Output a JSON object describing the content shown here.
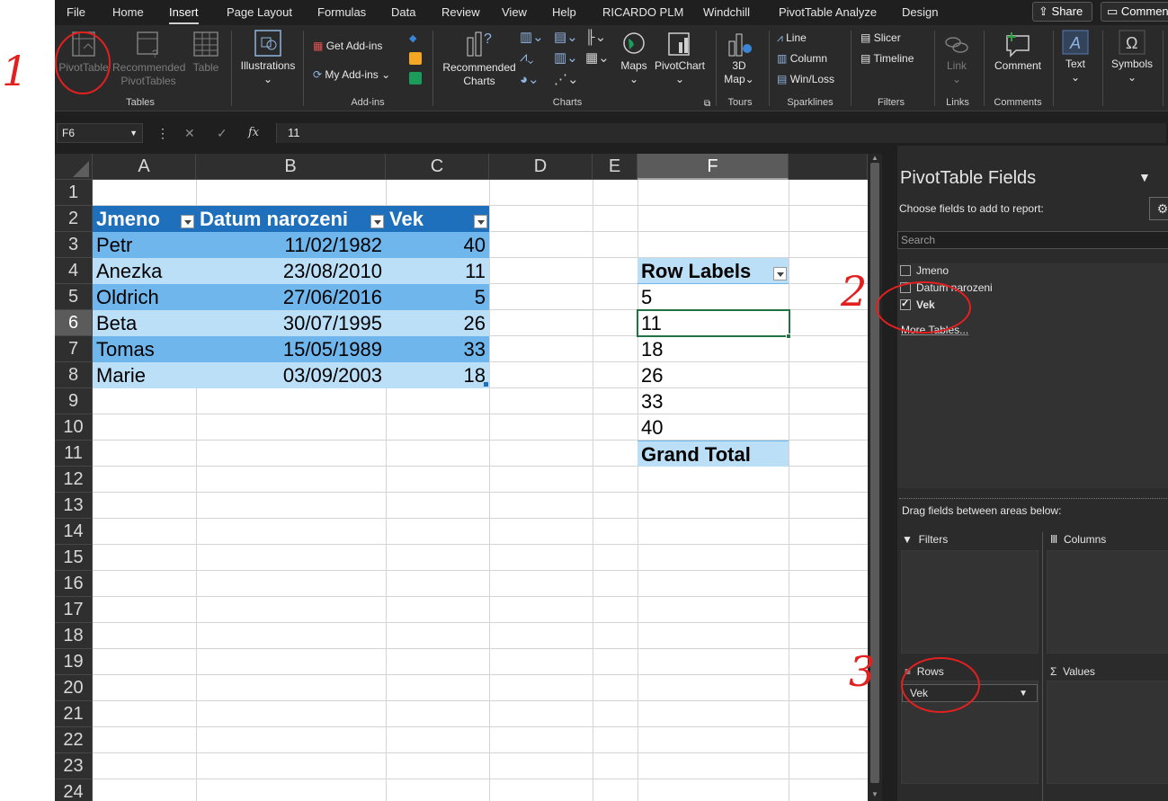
{
  "menu": {
    "tabs": [
      "File",
      "Home",
      "Insert",
      "Page Layout",
      "Formulas",
      "Data",
      "Review",
      "View",
      "Help",
      "RICARDO PLM",
      "Windchill",
      "PivotTable Analyze",
      "Design"
    ],
    "active": "Insert",
    "share": "Share",
    "comments": "Comments"
  },
  "ribbon": {
    "tables": {
      "pivottable": "PivotTable",
      "recommended_pivot_1": "Recommended",
      "recommended_pivot_2": "PivotTables",
      "table": "Table",
      "label": "Tables"
    },
    "illustrations": {
      "label_btn": "Illustrations"
    },
    "addins": {
      "get": "Get Add-ins",
      "my": "My Add-ins",
      "label": "Add-ins"
    },
    "charts": {
      "recommended_1": "Recommended",
      "recommended_2": "Charts",
      "maps": "Maps",
      "pivotchart": "PivotChart",
      "label": "Charts"
    },
    "tours": {
      "map_1": "3D",
      "map_2": "Map",
      "label": "Tours"
    },
    "sparklines": {
      "line": "Line",
      "column": "Column",
      "winloss": "Win/Loss",
      "label": "Sparklines"
    },
    "filters": {
      "slicer": "Slicer",
      "timeline": "Timeline",
      "label": "Filters"
    },
    "links": {
      "link": "Link",
      "label": "Links"
    },
    "comments": {
      "comment": "Comment",
      "label": "Comments"
    },
    "text": {
      "text": "Text"
    },
    "symbols": {
      "symbols": "Symbols"
    }
  },
  "formula_bar": {
    "name_box": "F6",
    "fx": "fx",
    "value": "11"
  },
  "sheet": {
    "columns": [
      "A",
      "B",
      "C",
      "D",
      "E",
      "F"
    ],
    "selected_column": "F",
    "rows": [
      "1",
      "2",
      "3",
      "4",
      "5",
      "6",
      "7",
      "8",
      "9",
      "10",
      "11",
      "12",
      "13",
      "14",
      "15",
      "16",
      "17",
      "18",
      "19",
      "20",
      "21",
      "22",
      "23",
      "24"
    ],
    "selected_row": "6",
    "table_headers": [
      "Jmeno",
      "Datum narozeni",
      "Vek"
    ],
    "table_rows": [
      [
        "Petr",
        "11/02/1982",
        "40"
      ],
      [
        "Anezka",
        "23/08/2010",
        "11"
      ],
      [
        "Oldrich",
        "27/06/2016",
        "5"
      ],
      [
        "Beta",
        "30/07/1995",
        "26"
      ],
      [
        "Tomas",
        "15/05/1989",
        "33"
      ],
      [
        "Marie",
        "03/09/2003",
        "18"
      ]
    ],
    "pivot_header": "Row Labels",
    "pivot_values": [
      "5",
      "11",
      "18",
      "26",
      "33",
      "40"
    ],
    "pivot_total": "Grand Total"
  },
  "pivot_panel": {
    "title": "PivotTable Fields",
    "choose": "Choose fields to add to report:",
    "search_placeholder": "Search",
    "fields": [
      {
        "name": "Jmeno",
        "checked": false
      },
      {
        "name": "Datum narozeni",
        "checked": false
      },
      {
        "name": "Vek",
        "checked": true
      }
    ],
    "more_tables": "More Tables...",
    "drag_hint": "Drag fields between areas below:",
    "areas": {
      "filters": "Filters",
      "columns": "Columns",
      "rows": "Rows",
      "values": "Values"
    },
    "rows_field": "Vek"
  },
  "annotations": {
    "marks": [
      "1",
      "2",
      "3"
    ],
    "color": "#e32020"
  },
  "colors": {
    "table_header": "#1e6fbc",
    "band_dark": "#6fb6ec",
    "band_light": "#bcdff8",
    "active_cell_border": "#217346"
  }
}
